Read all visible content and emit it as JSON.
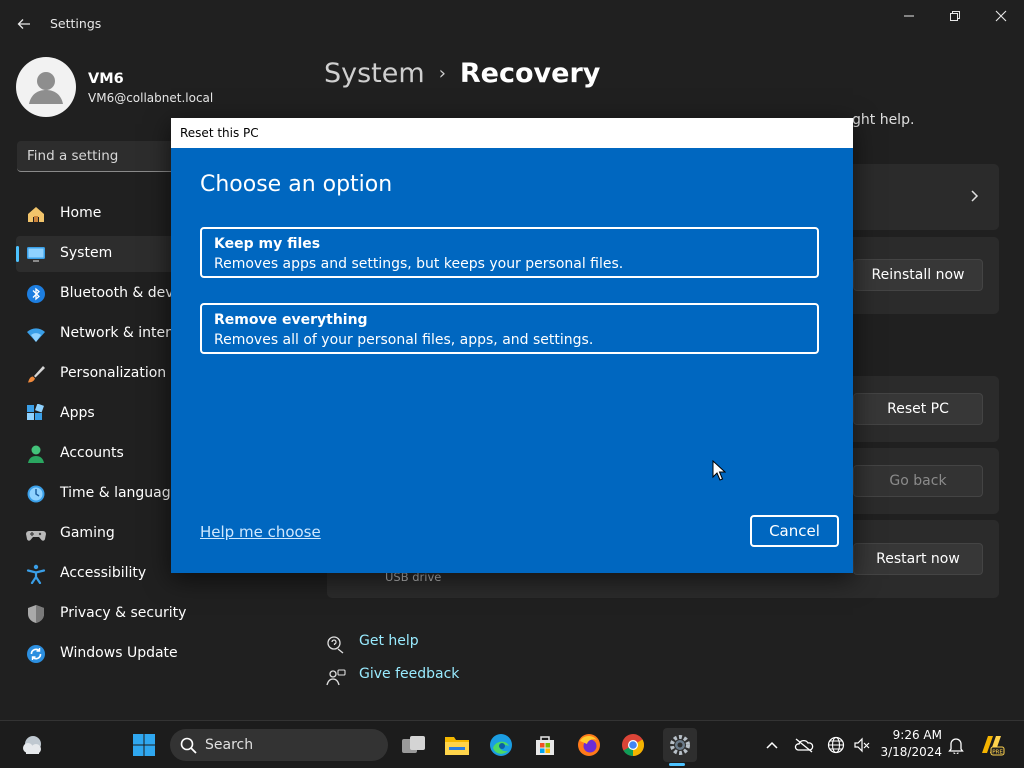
{
  "app": {
    "title": "Settings"
  },
  "user": {
    "name": "VM6",
    "email": "VM6@collabnet.local"
  },
  "search": {
    "placeholder": "Find a setting"
  },
  "nav": [
    {
      "label": "Home",
      "icon": "home-icon"
    },
    {
      "label": "System",
      "icon": "system-icon",
      "selected": true
    },
    {
      "label": "Bluetooth & devices",
      "icon": "bluetooth-icon"
    },
    {
      "label": "Network & internet",
      "icon": "wifi-icon"
    },
    {
      "label": "Personalization",
      "icon": "brush-icon"
    },
    {
      "label": "Apps",
      "icon": "apps-icon"
    },
    {
      "label": "Accounts",
      "icon": "accounts-icon"
    },
    {
      "label": "Time & language",
      "icon": "clock-icon"
    },
    {
      "label": "Gaming",
      "icon": "gamepad-icon"
    },
    {
      "label": "Accessibility",
      "icon": "accessibility-icon"
    },
    {
      "label": "Privacy & security",
      "icon": "shield-icon"
    },
    {
      "label": "Windows Update",
      "icon": "update-icon"
    }
  ],
  "breadcrumb": {
    "parent": "System",
    "separator": "›",
    "current": "Recovery"
  },
  "main": {
    "intro_tail": "ght help.",
    "buttons": {
      "reinstall": "Reinstall now",
      "reset": "Reset PC",
      "go_back": "Go back",
      "restart": "Restart now"
    },
    "usb_note": "USB drive",
    "links": {
      "get_help": "Get help",
      "give_feedback": "Give feedback"
    }
  },
  "dialog": {
    "title": "Reset this PC",
    "heading": "Choose an option",
    "options": [
      {
        "title": "Keep my files",
        "description": "Removes apps and settings, but keeps your personal files."
      },
      {
        "title": "Remove everything",
        "description": "Removes all of your personal files, apps, and settings."
      }
    ],
    "help_link": "Help me choose",
    "cancel": "Cancel"
  },
  "taskbar": {
    "search_label": "Search",
    "time": "9:26 AM",
    "date": "3/18/2024",
    "apps": [
      "windows-start-icon",
      "task-view-icon",
      "file-explorer-icon",
      "edge-icon",
      "store-icon",
      "firefox-icon",
      "chrome-icon",
      "settings-app-icon"
    ]
  },
  "colors": {
    "accent": "#4cc2ff",
    "dialog_blue": "#0067c0",
    "background": "#202020",
    "link": "#99ebff"
  }
}
